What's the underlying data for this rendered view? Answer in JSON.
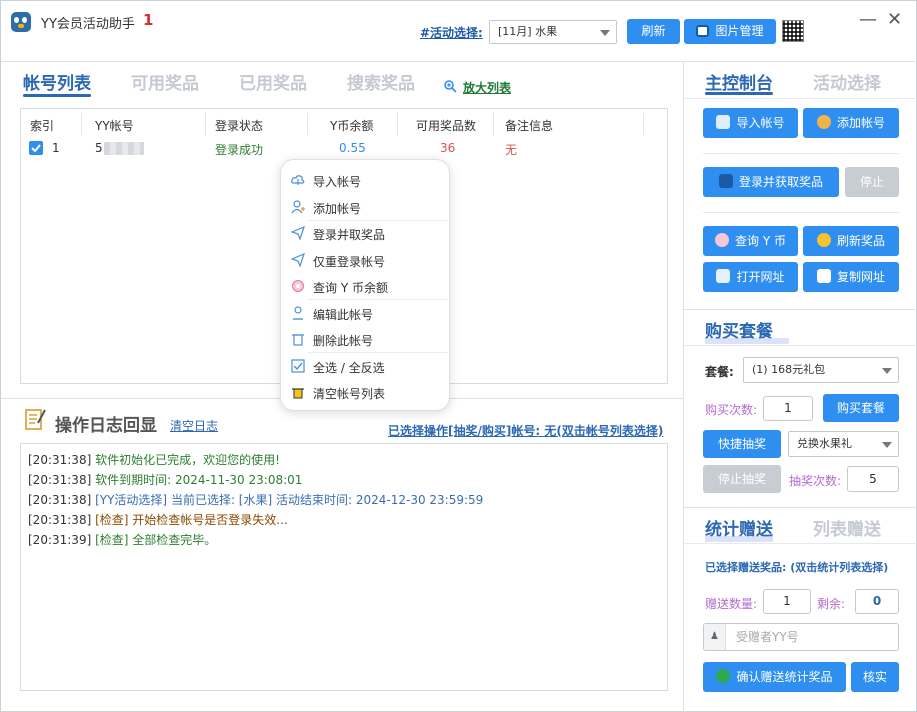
{
  "app": {
    "title": "YY会员活动助手",
    "badge": "1"
  },
  "activity": {
    "label": "#活动选择:",
    "selected": "[11月] 水果"
  },
  "toolbar": {
    "refresh": "刷新",
    "image_manage": "图片管理"
  },
  "left_tabs": [
    "帐号列表",
    "可用奖品",
    "已用奖品",
    "搜索奖品"
  ],
  "enlarge_list": "放大列表",
  "table": {
    "headers": [
      "索引",
      "YY帐号",
      "登录状态",
      "Y币余额",
      "可用奖品数",
      "备注信息"
    ],
    "rows": [
      {
        "index": "1",
        "account": "5",
        "status": "登录成功",
        "balance": "0.55",
        "prizes": "36",
        "note": "无"
      }
    ]
  },
  "context_menu": [
    "导入帐号",
    "添加帐号",
    "登录并取奖品",
    "仅重登录帐号",
    "查询 Y 币余额",
    "编辑此帐号",
    "删除此帐号",
    "全选 / 全反选",
    "清空帐号列表"
  ],
  "log": {
    "title": "操作日志回显",
    "clear": "清空日志",
    "selected_op": "已选择操作[抽奖/购买]帐号: 无(双击帐号列表选择)",
    "lines": [
      {
        "time": "[20:31:38]",
        "tag": "",
        "text": "软件初始化已完成，欢迎您的使用!",
        "value": "",
        "color": "#2e7d32"
      },
      {
        "time": "[20:31:38]",
        "tag": "",
        "text": "软件到期时间: ",
        "value": "2024-11-30 23:08:01",
        "color": "#2e7d32"
      },
      {
        "time": "[20:31:38]",
        "tag": "[YY活动选择]",
        "text": " 当前已选择: [水果] 活动结束时间: ",
        "value": "2024-12-30 23:59:59",
        "color": "#3a6db3"
      },
      {
        "time": "[20:31:38]",
        "tag": "[检查]",
        "text": " 开始检查帐号是否登录失效...",
        "value": "",
        "color": "#8a4b00"
      },
      {
        "time": "[20:31:39]",
        "tag": "[检查]",
        "text": " 全部检查完毕。",
        "value": "",
        "color": "#2e7d32"
      }
    ]
  },
  "right_tabs": {
    "console": "主控制台",
    "activity": "活动选择"
  },
  "console": {
    "import": "导入帐号",
    "add": "添加帐号",
    "login_get": "登录并获取奖品",
    "stop": "停止",
    "query_y": "查询 Y 币",
    "refresh_prize": "刷新奖品",
    "open_url": "打开网址",
    "copy_url": "复制网址"
  },
  "buy": {
    "title": "购买套餐",
    "package_label": "套餐:",
    "package_value": "(1) 168元礼包",
    "count_label": "购买次数:",
    "count_value": "1",
    "buy_button": "购买套餐",
    "quick_draw": "快捷抽奖",
    "exchange_value": "兑换水果礼",
    "stop_draw": "停止抽奖",
    "draw_count_label": "抽奖次数:",
    "draw_count_value": "5"
  },
  "gift": {
    "tab_stats": "统计赠送",
    "tab_list": "列表赠送",
    "selected": "已选择赠送奖品: (双击统计列表选择)",
    "qty_label": "赠送数量:",
    "qty_value": "1",
    "remain_label": "剩余:",
    "remain_value": "0",
    "recipient_placeholder": "受赠者YY号",
    "confirm": "确认赠送统计奖品",
    "verify": "核实"
  },
  "colors": {
    "accent": "#2f8ff0",
    "tab_active": "#2c68b3",
    "success": "#2e7d32",
    "balance": "#2f8ff0",
    "prizes": "#d9534f",
    "note": "#d9534f",
    "purple": "#b36bd1"
  }
}
